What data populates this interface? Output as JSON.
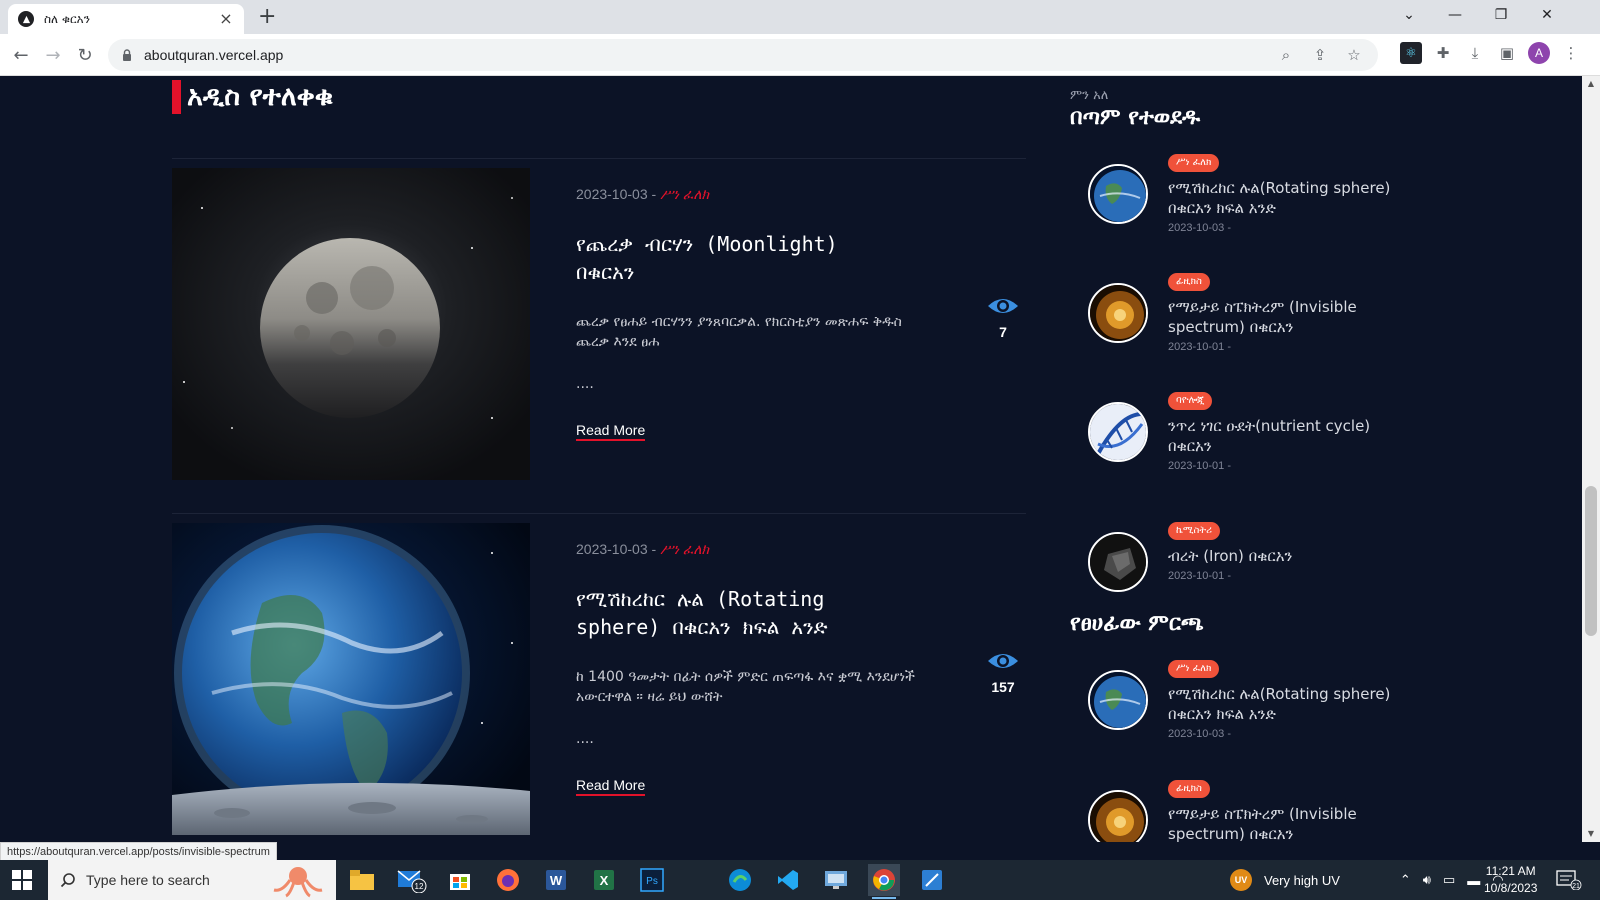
{
  "browser": {
    "tab_title": "ስለ ቁርአን",
    "url": "aboutquran.vercel.app",
    "profile_initial": "A",
    "status_url": "https://aboutquran.vercel.app/posts/invisible-spectrum"
  },
  "main": {
    "section_title": "አዲስ የተለቀቁ",
    "posts": [
      {
        "date": "2023-10-03",
        "sep": " - ",
        "category": "ሥነ ፈለክ",
        "title": "የጨረቃ ብርሃን (Moonlight) በቁርአን",
        "excerpt": "ጨረቃ የፀሐይ ብርሃንን ያንጸባርቃል. የክርስቲያን መጽሐፍ ቅዱስ ጨረቃ እንደ ፀሐ",
        "dots": "....",
        "read_more": "Read More",
        "views": "7",
        "image": "moon"
      },
      {
        "date": "2023-10-03",
        "sep": " - ",
        "category": "ሥነ ፈለክ",
        "title": "የሚሽከረከር ሉል (Rotating sphere) በቁርአን ክፍል አንድ",
        "excerpt": "ከ 1400 ዓመታት በፊት ሰዎች ምድር ጠፍጣፋ እና ቋሚ እንደሆነች አውርተዋል ። ዛሬ ይህ ውሸት",
        "dots": "....",
        "read_more": "Read More",
        "views": "157",
        "image": "earth"
      }
    ]
  },
  "sidebar": {
    "subheading": "ምን አለ",
    "popular_heading": "በጣም የተወደዱ",
    "editor_heading": "የፀሀፊው ምርጫ",
    "popular": [
      {
        "badge": "ሥነ ፈለክ",
        "title": "የሚሽከረከር ሉል(Rotating sphere) በቁርአን ክፍል አንድ",
        "date": "2023-10-03 -",
        "image": "earth"
      },
      {
        "badge": "ፊዚክስ",
        "title": "የማይታይ ስፔክትረም (Invisible spectrum) በቁርአን",
        "date": "2023-10-01 -",
        "image": "gold"
      },
      {
        "badge": "ባዮሎጂ",
        "title": "ንጥረ ነገር ዑደት(nutrient cycle) በቁርአን",
        "date": "2023-10-01 -",
        "image": "dna"
      },
      {
        "badge": "ኬሚስትሪ",
        "title": "ብረት (Iron) በቁርአን",
        "date": "2023-10-01 -",
        "image": "iron"
      }
    ],
    "editor": [
      {
        "badge": "ሥነ ፈለክ",
        "title": "የሚሽከረከር ሉል(Rotating sphere) በቁርአን ክፍል አንድ",
        "date": "2023-10-03 -",
        "image": "earth"
      },
      {
        "badge": "ፊዚክስ",
        "title": "የማይታይ ስፔክትረም (Invisible spectrum) በቁርአን",
        "date": "",
        "image": "gold"
      }
    ]
  },
  "taskbar": {
    "search_placeholder": "Type here to search",
    "mail_count": "12",
    "weather": "Very high UV",
    "uv_label": "UV",
    "time": "11:21 AM",
    "date": "10/8/2023",
    "notifications": "21"
  },
  "colors": {
    "page_bg": "#0c1326",
    "accent_red": "#e3122a",
    "badge_orange": "#f0523a",
    "view_icon_blue": "#3b8fe0"
  }
}
